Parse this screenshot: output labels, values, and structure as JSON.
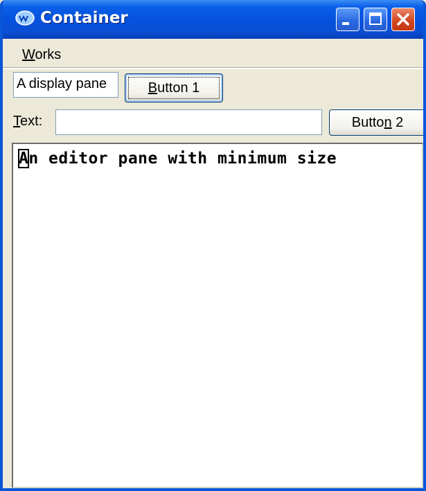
{
  "window": {
    "title": "Container",
    "controls": [
      "minimize",
      "maximize",
      "close"
    ]
  },
  "menubar": {
    "items": [
      {
        "label_first": "W",
        "label_rest": "orks"
      }
    ]
  },
  "toolbar": {
    "display_pane_text": "A display pane",
    "button1": {
      "mnemonic": "B",
      "rest": "utton 1"
    },
    "text_label": {
      "mnemonic": "T",
      "rest": "ext:"
    },
    "text_field_value": "",
    "button2": {
      "pre": "Butto",
      "mnemonic": "n",
      "rest": " 2"
    }
  },
  "editor": {
    "first_char": "A",
    "rest_text": "n editor pane with minimum size"
  },
  "colors": {
    "titlebar": "#0552de",
    "window_bg": "#ece9d8",
    "close_button": "#d0431d"
  }
}
